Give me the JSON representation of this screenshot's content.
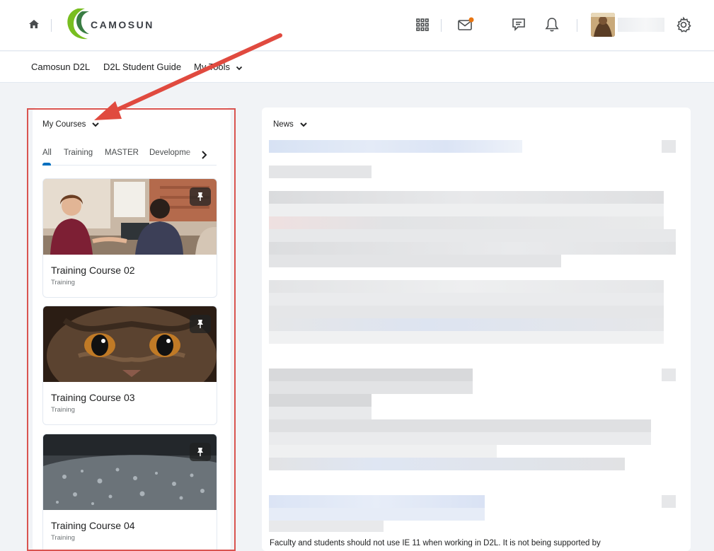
{
  "header": {
    "logo_text": "CAMOSUN",
    "icons": [
      "home-icon",
      "waffle-icon",
      "mail-icon",
      "chat-icon",
      "bell-icon",
      "gear-icon"
    ],
    "mail_badge_color": "#e87511"
  },
  "navbar": {
    "links": [
      "Camosun D2L",
      "D2L Student Guide",
      "My Tools"
    ]
  },
  "courses_widget": {
    "title": "My Courses",
    "tabs": [
      "All",
      "Training",
      "MASTER",
      "Developme"
    ],
    "cards": [
      {
        "title": "Training Course 02",
        "subtitle": "Training"
      },
      {
        "title": "Training Course 03",
        "subtitle": "Training"
      },
      {
        "title": "Training Course 04",
        "subtitle": "Training"
      }
    ]
  },
  "news_widget": {
    "title": "News",
    "footer_text": "Faculty and students should not use IE 11 when working in D2L. It is not being supported by"
  },
  "colors": {
    "accent": "#006fbf",
    "highlight": "#d9534f",
    "logo_green": "#78be20"
  }
}
